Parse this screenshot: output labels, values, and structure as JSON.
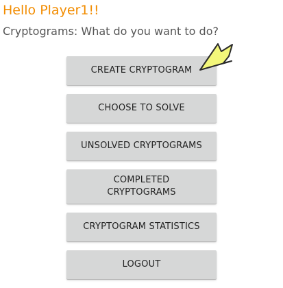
{
  "header": {
    "greeting": "Hello Player1!!",
    "prompt": "Cryptograms: What do you want to do?"
  },
  "menu": {
    "buttons": [
      {
        "label": "CREATE CRYPTOGRAM"
      },
      {
        "label": "CHOOSE TO SOLVE"
      },
      {
        "label": "UNSOLVED CRYPTOGRAMS"
      },
      {
        "label": "COMPLETED\nCRYPTOGRAMS"
      },
      {
        "label": "CRYPTOGRAM STATISTICS"
      },
      {
        "label": "LOGOUT"
      }
    ]
  },
  "colors": {
    "greeting": "#f28c00",
    "button_bg": "#d6d7d7",
    "annotation_arrow": "#f3f77a"
  },
  "annotation": {
    "icon": "yellow-arrow-icon"
  }
}
